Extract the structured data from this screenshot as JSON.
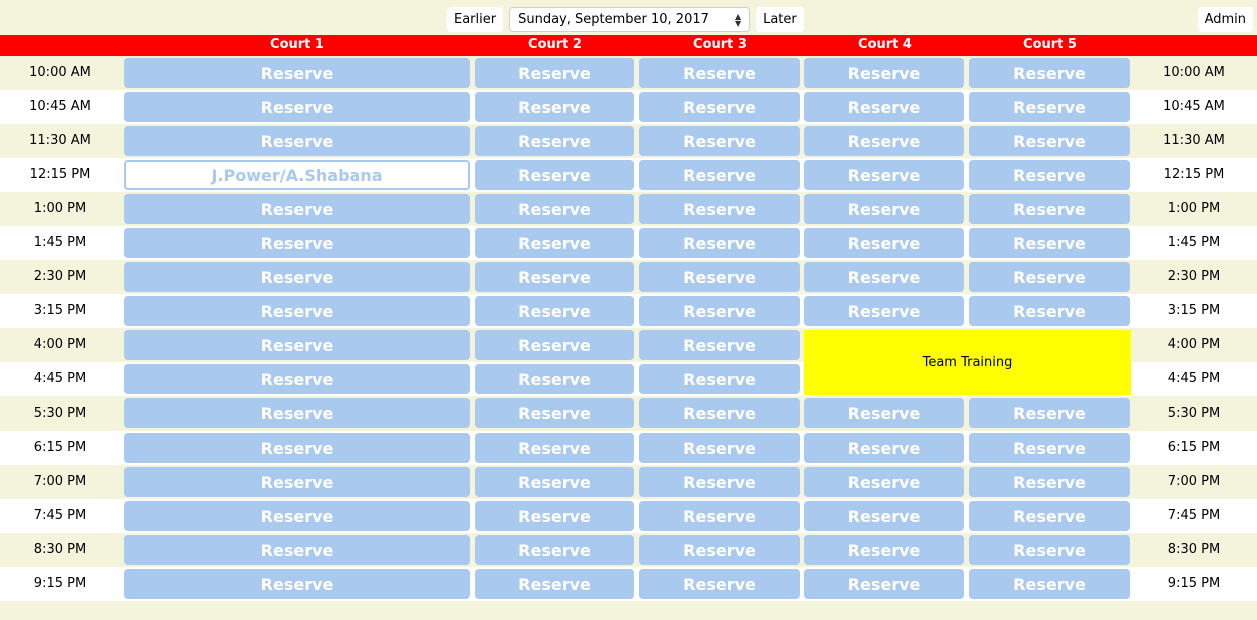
{
  "nav": {
    "earlier_label": "Earlier",
    "date_value": "Sunday, September 10, 2017",
    "later_label": "Later",
    "admin_label": "Admin"
  },
  "courts": [
    "Court 1",
    "Court 2",
    "Court 3",
    "Court 4",
    "Court 5"
  ],
  "times": [
    "10:00 AM",
    "10:45 AM",
    "11:30 AM",
    "12:15 PM",
    "1:00 PM",
    "1:45 PM",
    "2:30 PM",
    "3:15 PM",
    "4:00 PM",
    "4:45 PM",
    "5:30 PM",
    "6:15 PM",
    "7:00 PM",
    "7:45 PM",
    "8:30 PM",
    "9:15 PM"
  ],
  "reserve_label": "Reserve",
  "booking": {
    "time_index": 3,
    "court_index": 0,
    "label": "J.Power/A.Shabana"
  },
  "training": {
    "label": "Team Training",
    "courts": [
      3,
      4
    ],
    "time_indices": [
      8,
      9
    ]
  },
  "colors": {
    "header_red": "#ff0000",
    "slot_blue": "#a9c9ee",
    "training_yellow": "#ffff00",
    "row_cream": "#f4f3dc",
    "row_white": "#ffffff"
  }
}
